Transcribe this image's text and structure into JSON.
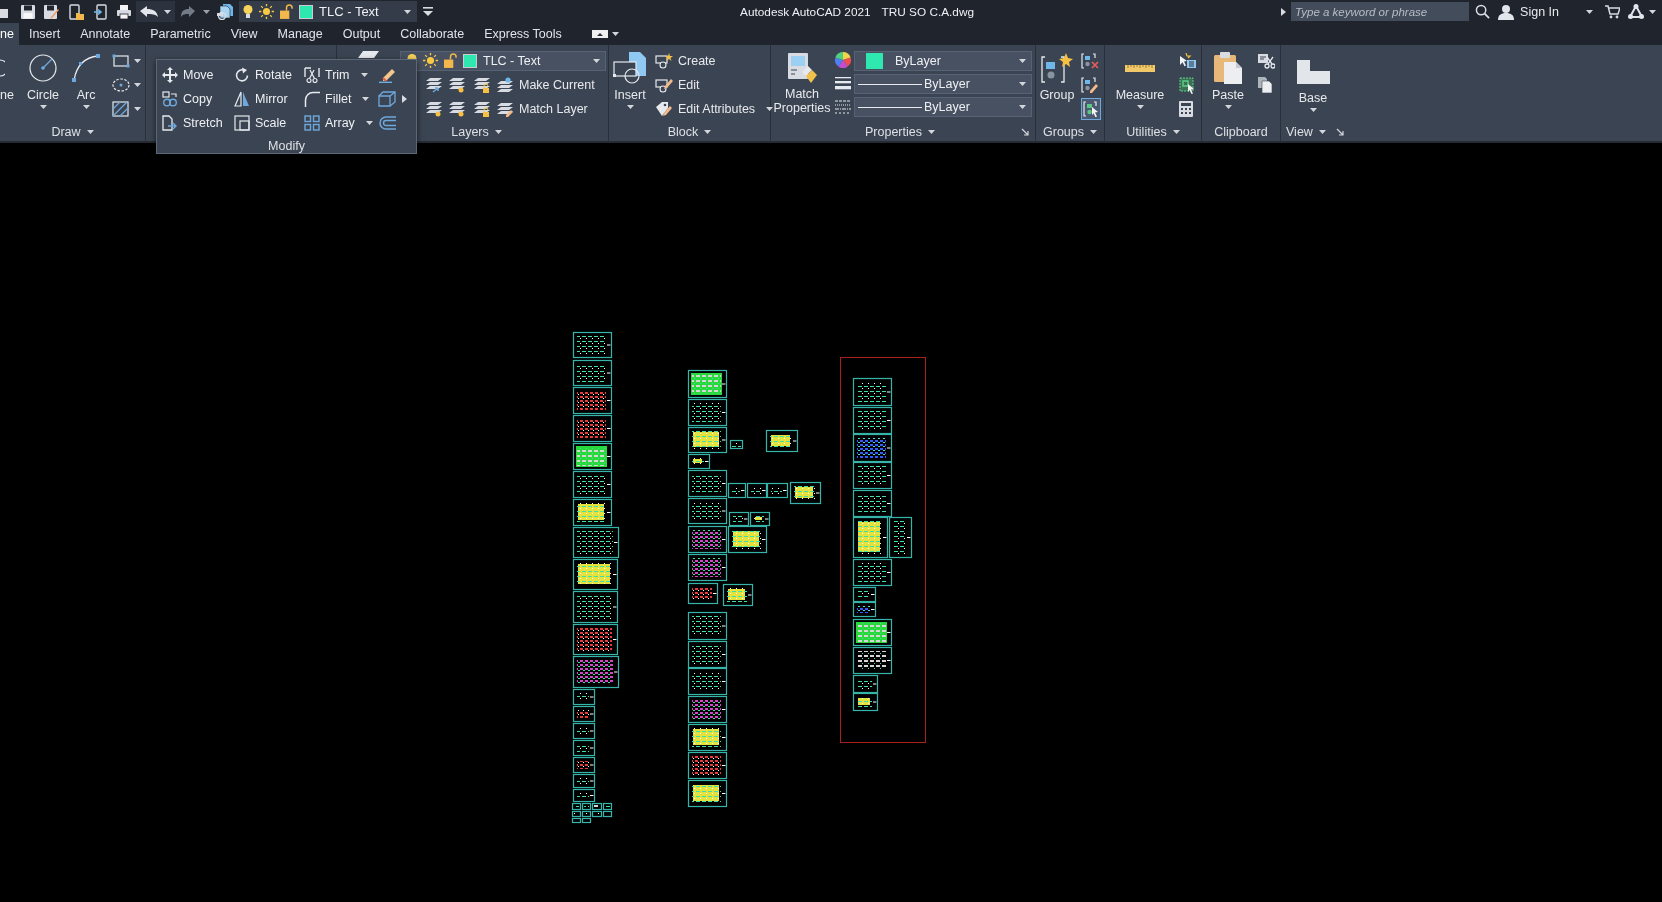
{
  "quick_access": {
    "layer": "TLC - Text"
  },
  "title_bar": {
    "app_name": "Autodesk AutoCAD 2021",
    "file_name": "TRU SO C.A.dwg",
    "search": {
      "placeholder": "Type a keyword or phrase"
    },
    "sign_in": "Sign In"
  },
  "tabs": [
    {
      "label": "ne",
      "selected": true
    },
    {
      "label": "Insert",
      "selected": false
    },
    {
      "label": "Annotate",
      "selected": false
    },
    {
      "label": "Parametric",
      "selected": false
    },
    {
      "label": "View",
      "selected": false
    },
    {
      "label": "Manage",
      "selected": false
    },
    {
      "label": "Output",
      "selected": false
    },
    {
      "label": "Collaborate",
      "selected": false
    },
    {
      "label": "Express Tools",
      "selected": false
    }
  ],
  "ribbon": {
    "draw": {
      "title": "Draw",
      "tools": [
        "ne",
        "Circle",
        "Arc"
      ]
    },
    "modify": {
      "title": "Modify",
      "expanded": true,
      "tools": [
        {
          "label": "Move",
          "dropdown": false
        },
        {
          "label": "Rotate",
          "dropdown": false
        },
        {
          "label": "Trim",
          "dropdown": true
        },
        {
          "label": "Copy",
          "dropdown": false
        },
        {
          "label": "Mirror",
          "dropdown": false
        },
        {
          "label": "Fillet",
          "dropdown": true
        },
        {
          "label": "Stretch",
          "dropdown": false
        },
        {
          "label": "Scale",
          "dropdown": false
        },
        {
          "label": "Array",
          "dropdown": true
        }
      ]
    },
    "layers": {
      "title": "Layers",
      "current_layer": "TLC - Text",
      "tools": [
        "Make Current",
        "Match Layer"
      ]
    },
    "block": {
      "title": "Block",
      "insert": "Insert",
      "tools": [
        {
          "label": "Create",
          "dropdown": false
        },
        {
          "label": "Edit",
          "dropdown": false
        },
        {
          "label": "Edit Attributes",
          "dropdown": true
        }
      ]
    },
    "properties": {
      "title": "Properties",
      "match": "Match Properties",
      "color_setting": "ByLayer",
      "lineweight": "ByLayer",
      "linetype": "ByLayer"
    },
    "groups": {
      "title": "Groups",
      "group": "Group",
      "selection_on": true
    },
    "utilities": {
      "title": "Utilities",
      "measure": "Measure"
    },
    "clipboard": {
      "title": "Clipboard",
      "paste": "Paste"
    },
    "view": {
      "title": "View",
      "base": "Base"
    }
  }
}
